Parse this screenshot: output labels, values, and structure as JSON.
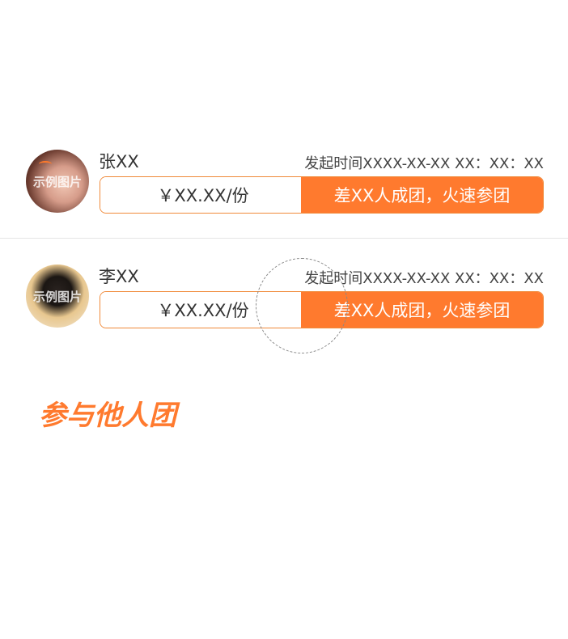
{
  "groups": [
    {
      "name": "张XX",
      "time": "发起时间XXXX-XX-XX XX：XX：XX",
      "price": "￥XX.XX/份",
      "action": "差XX人成团，火速参团",
      "avatar_watermark": "示例图片"
    },
    {
      "name": "李XX",
      "time": "发起时间XXXX-XX-XX XX：XX：XX",
      "price": "￥XX.XX/份",
      "action": "差XX人成团，火速参团",
      "avatar_watermark": "示例图片"
    }
  ],
  "section": {
    "title": "参与他人团"
  },
  "colors": {
    "accent": "#ff7a2e",
    "text": "#333333",
    "divider": "#e4e4e4"
  }
}
